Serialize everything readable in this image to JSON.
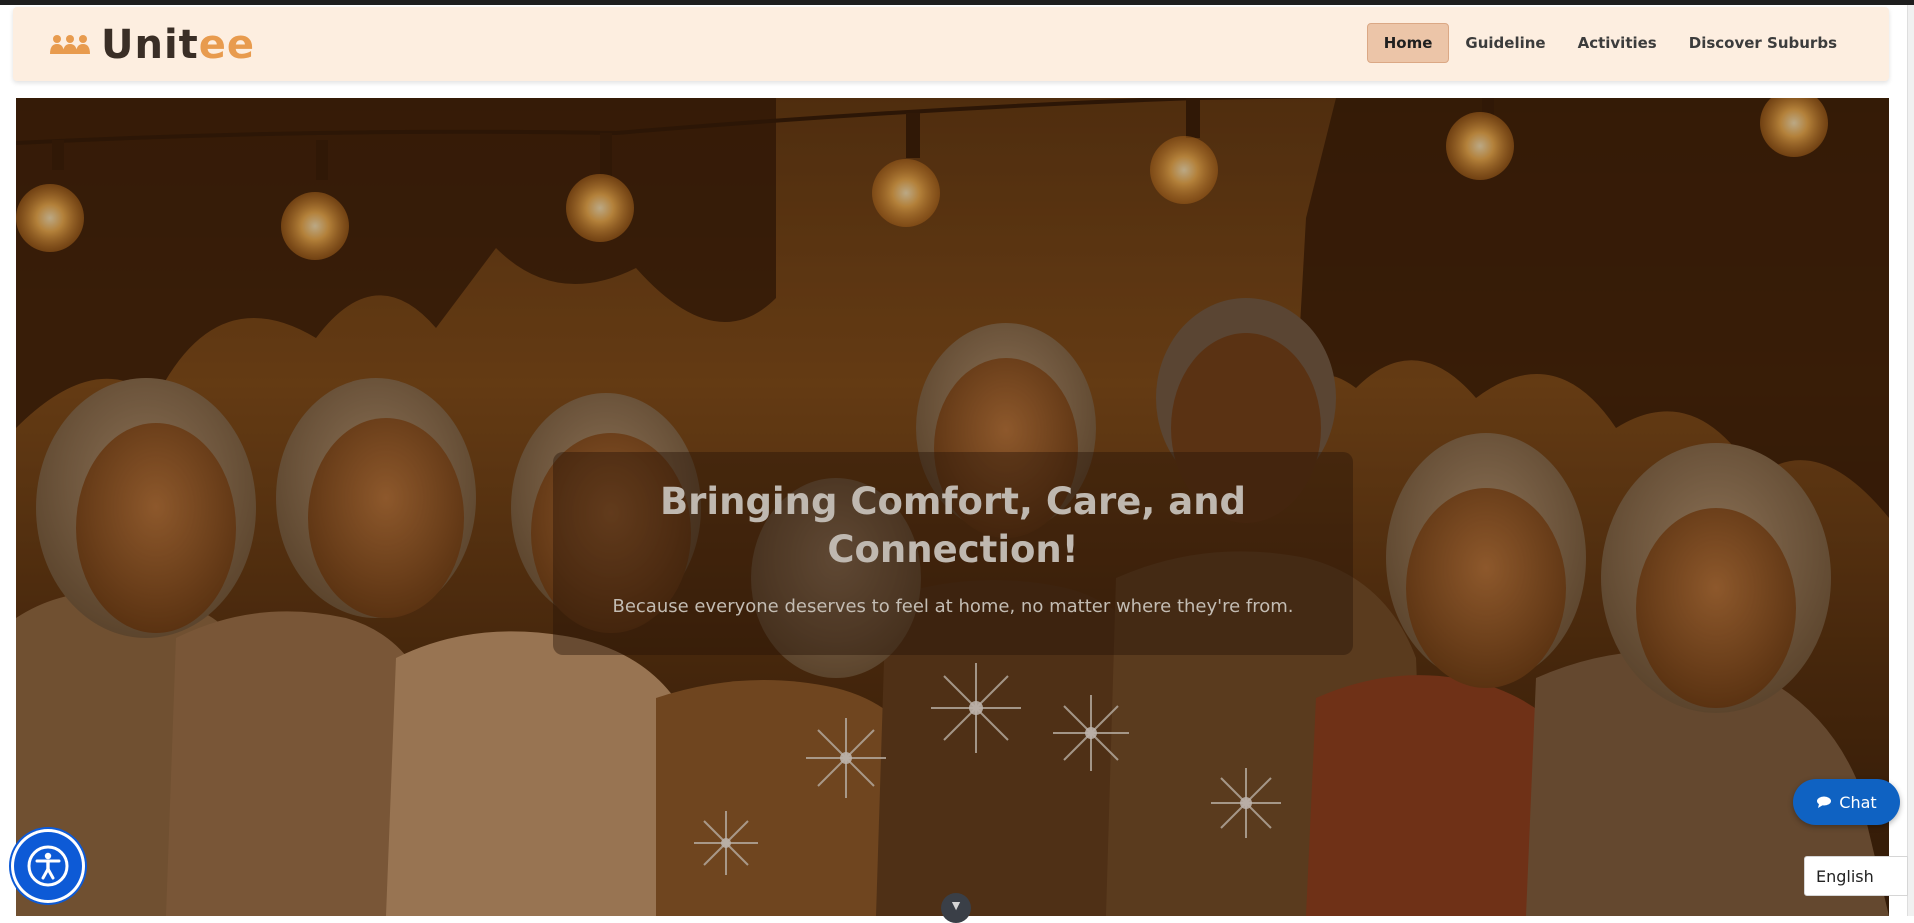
{
  "app": {
    "brand_prefix": "Unit",
    "brand_accent": "ee",
    "brand_icon": "people-group-icon"
  },
  "nav": {
    "items": [
      {
        "label": "Home",
        "active": true
      },
      {
        "label": "Guideline",
        "active": false
      },
      {
        "label": "Activities",
        "active": false
      },
      {
        "label": "Discover Suburbs",
        "active": false
      }
    ]
  },
  "hero": {
    "title": "Bringing Comfort, Care, and Connection!",
    "subtitle": "Because everyone deserves to feel at home, no matter where they're from.",
    "scroll_icon": "chevron-down-icon"
  },
  "widgets": {
    "chat_label": "Chat",
    "chat_icon": "speech-bubble-icon",
    "language": "English",
    "accessibility_icon": "accessibility-person-icon"
  },
  "colors": {
    "navbar_bg": "#fdeee0",
    "brand_text": "#3a2e26",
    "brand_accent": "#e89b4e",
    "active_nav_bg": "#ecc5a8",
    "chat_bg": "#0f62c2",
    "a11y_bg": "#0d5ad6"
  }
}
